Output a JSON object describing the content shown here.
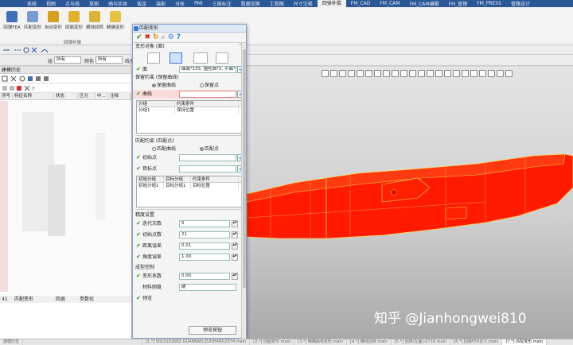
{
  "menubar": {
    "items": [
      "系统",
      "视图",
      "点与线",
      "草图",
      "曲与实体",
      "钣金",
      "装配",
      "分析",
      "PMI",
      "三维标注",
      "数据交换",
      "工程图",
      "尺寸注释",
      "回弹补偿",
      "FM_CAD",
      "FM_CAM",
      "FM_CAM编辑",
      "FM_管理",
      "FM_PRESS",
      "管路设计"
    ],
    "active_index": 13
  },
  "ribbon": {
    "buttons": [
      "回弹FEA",
      "匹配变形",
      "自动变形",
      "回面变形",
      "横线回转",
      "精确变形"
    ],
    "group_label": "回弹补偿"
  },
  "toolbar2": {
    "label_group": "组",
    "select_group": "所有",
    "label_color": "颜色",
    "select_color": "所有",
    "label_linewidth": "线宽"
  },
  "leftpanel": {
    "title": "建模历史",
    "columns": [
      "序号",
      "特征名称",
      "状态",
      "区分",
      "中...",
      "注释"
    ],
    "row": {
      "num": "41",
      "name": "匹配变形",
      "status": "回退",
      "type": "参数化"
    }
  },
  "dialog": {
    "title": "匹配变形",
    "section_object": "变形对象 (面)",
    "face_label": "面",
    "face_value": "曲面*155, 圆柱面*2, 平面*",
    "section_keep": "保留约束 (保留曲线)",
    "keep_opt1": "保留曲线",
    "keep_opt2": "保留点",
    "curve_label": "曲线",
    "table1_cols": [
      "分组",
      "约束条件"
    ],
    "table1_row": [
      "分组1",
      "保持位置"
    ],
    "section_match": "匹配约束 (匹配点)",
    "match_opt1": "匹配曲线",
    "match_opt2": "匹配点",
    "init_pt_label": "初始点",
    "target_pt_label": "目标点",
    "table2_cols": [
      "初始分组",
      "目标分组",
      "约束条件"
    ],
    "table2_row": [
      "初始分组1",
      "目标分组1",
      "目标位置"
    ],
    "section_precision": "精度设置",
    "iter_label": "迭代次数",
    "iter_value": "5",
    "initpts_label": "初始点数",
    "initpts_value": "21",
    "dist_err_label": "距离误差",
    "dist_err_value": "0.01",
    "ang_err_label": "角度误差",
    "ang_err_value": "1.00",
    "section_shape": "成型控制",
    "deform_coef_label": "变形系数",
    "deform_coef_value": "0.00",
    "hardness_label": "材料刚度",
    "hardness_value": "硬",
    "preview_label": "预览",
    "bottom_button": "预览按钮"
  },
  "watermark": "知乎 @Jianhongwei810",
  "statusbar": {
    "items": [
      "建模历史",
      "",
      "[1.*] 0010102682-GUANBAN-ZUOHANG2574.main",
      "[2.*] 回面变形.main",
      "[3.*] 精确曲线变形.main",
      "[4.*] 横线回转.main",
      "[5.*] 回转(左面)-0716.main",
      "[6.*] 回弹FEA定义.main",
      "[7.*] 匹配变形.main"
    ]
  },
  "colors": {
    "menubar_bg": "#2b5797",
    "part_red": "#ff1a00",
    "part_edge": "#ffd84a",
    "check_green": "#2a8a2a"
  }
}
